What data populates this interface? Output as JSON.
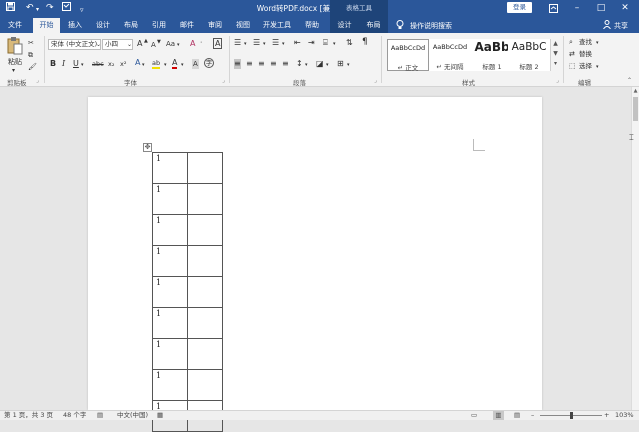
{
  "titlebar": {
    "doc_title": "Word转PDF.docx [兼容模式] - Word",
    "context_group": "表格工具",
    "login": "登录",
    "save_icon": "save-icon",
    "undo_icon": "undo-icon",
    "redo_icon": "redo-icon"
  },
  "tabs": [
    {
      "label": "文件"
    },
    {
      "label": "开始"
    },
    {
      "label": "插入"
    },
    {
      "label": "设计"
    },
    {
      "label": "布局"
    },
    {
      "label": "引用"
    },
    {
      "label": "邮件"
    },
    {
      "label": "审阅"
    },
    {
      "label": "视图"
    },
    {
      "label": "开发工具"
    },
    {
      "label": "帮助"
    },
    {
      "label": "设计"
    },
    {
      "label": "布局"
    }
  ],
  "tell_me": "操作说明搜索",
  "share": "共享",
  "ribbon": {
    "clipboard": {
      "paste": "粘贴",
      "label": "剪贴板"
    },
    "font": {
      "font_name": "宋体 (中文正文)",
      "font_size": "小四",
      "grow": "A",
      "shrink": "A",
      "case": "Aa",
      "clear_format": "A",
      "char_border": "A",
      "bold": "B",
      "italic": "I",
      "underline": "U",
      "strike": "abc",
      "subscript": "x₂",
      "superscript": "x²",
      "text_effect": "A",
      "highlight": "ab",
      "font_color": "A",
      "phonetic": "A",
      "enclose": "字",
      "label": "字体"
    },
    "paragraph": {
      "label": "段落"
    },
    "styles": {
      "items": [
        {
          "sample": "AaBbCcDd",
          "name": "正文"
        },
        {
          "sample": "AaBbCcDd",
          "name": "无间隔"
        },
        {
          "sample": "AaBb",
          "name": "标题 1"
        },
        {
          "sample": "AaBbC",
          "name": "标题 2"
        }
      ],
      "label": "样式"
    },
    "editing": {
      "find": "查找",
      "replace": "替换",
      "select": "选择",
      "label": "编辑"
    }
  },
  "table": {
    "rows": [
      [
        "1",
        ""
      ],
      [
        "1",
        ""
      ],
      [
        "1",
        ""
      ],
      [
        "1",
        ""
      ],
      [
        "1",
        ""
      ],
      [
        "1",
        ""
      ],
      [
        "1",
        ""
      ],
      [
        "1",
        ""
      ],
      [
        "1",
        ""
      ]
    ]
  },
  "status": {
    "page": "第 1 页，共 3 页",
    "words": "48 个字",
    "language": "中文(中国)",
    "zoom": "103%"
  }
}
